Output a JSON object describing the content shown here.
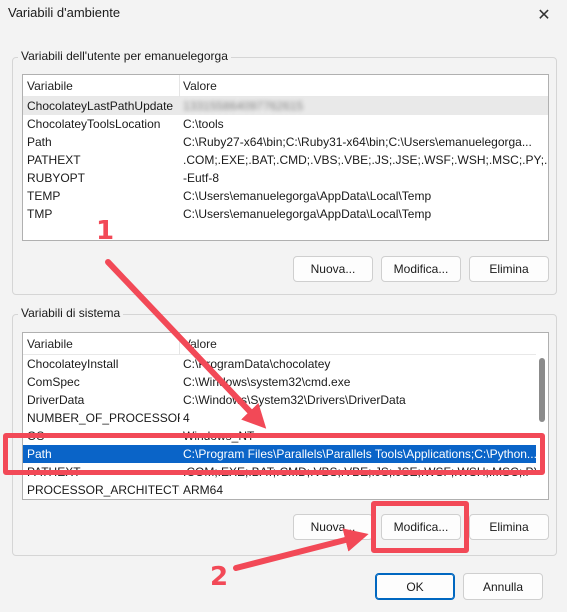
{
  "window": {
    "title": "Variabili d'ambiente",
    "close_glyph": "✕"
  },
  "user_group": {
    "label": "Variabili dell'utente per emanuelegorga",
    "columns": [
      "Variabile",
      "Valore"
    ],
    "rows": [
      {
        "name": "ChocolateyLastPathUpdate",
        "value": "133155864097762615"
      },
      {
        "name": "ChocolateyToolsLocation",
        "value": "C:\\tools"
      },
      {
        "name": "Path",
        "value": "C:\\Ruby27-x64\\bin;C:\\Ruby31-x64\\bin;C:\\Users\\emanuelegorga..."
      },
      {
        "name": "PATHEXT",
        "value": ".COM;.EXE;.BAT;.CMD;.VBS;.VBE;.JS;.JSE;.WSF;.WSH;.MSC;.PY;.PYW..."
      },
      {
        "name": "RUBYOPT",
        "value": "-Eutf-8"
      },
      {
        "name": "TEMP",
        "value": "C:\\Users\\emanuelegorga\\AppData\\Local\\Temp"
      },
      {
        "name": "TMP",
        "value": "C:\\Users\\emanuelegorga\\AppData\\Local\\Temp"
      }
    ],
    "buttons": {
      "new": "Nuova...",
      "edit": "Modifica...",
      "delete": "Elimina"
    }
  },
  "system_group": {
    "label": "Variabili di sistema",
    "columns": [
      "Variabile",
      "Valore"
    ],
    "rows": [
      {
        "name": "ChocolateyInstall",
        "value": "C:\\ProgramData\\chocolatey"
      },
      {
        "name": "ComSpec",
        "value": "C:\\Windows\\system32\\cmd.exe"
      },
      {
        "name": "DriverData",
        "value": "C:\\Windows\\System32\\Drivers\\DriverData"
      },
      {
        "name": "NUMBER_OF_PROCESSORS",
        "value": "4"
      },
      {
        "name": "OS",
        "value": "Windows_NT"
      },
      {
        "name": "Path",
        "value": "C:\\Program Files\\Parallels\\Parallels Tools\\Applications;C:\\Python..."
      },
      {
        "name": "PATHEXT",
        "value": ".COM;.EXE;.BAT;.CMD;.VBS;.VBE;.JS;.JSE;.WSF;.WSH;.MSC;.PY;.PYW"
      },
      {
        "name": "PROCESSOR_ARCHITECTURE",
        "value": "ARM64"
      }
    ],
    "selected_index": 5,
    "buttons": {
      "new": "Nuova...",
      "edit": "Modifica...",
      "delete": "Elimina"
    }
  },
  "footer": {
    "ok": "OK",
    "cancel": "Annulla"
  },
  "annotations": {
    "color": "#f24957",
    "label_1": "1",
    "label_2": "2"
  }
}
